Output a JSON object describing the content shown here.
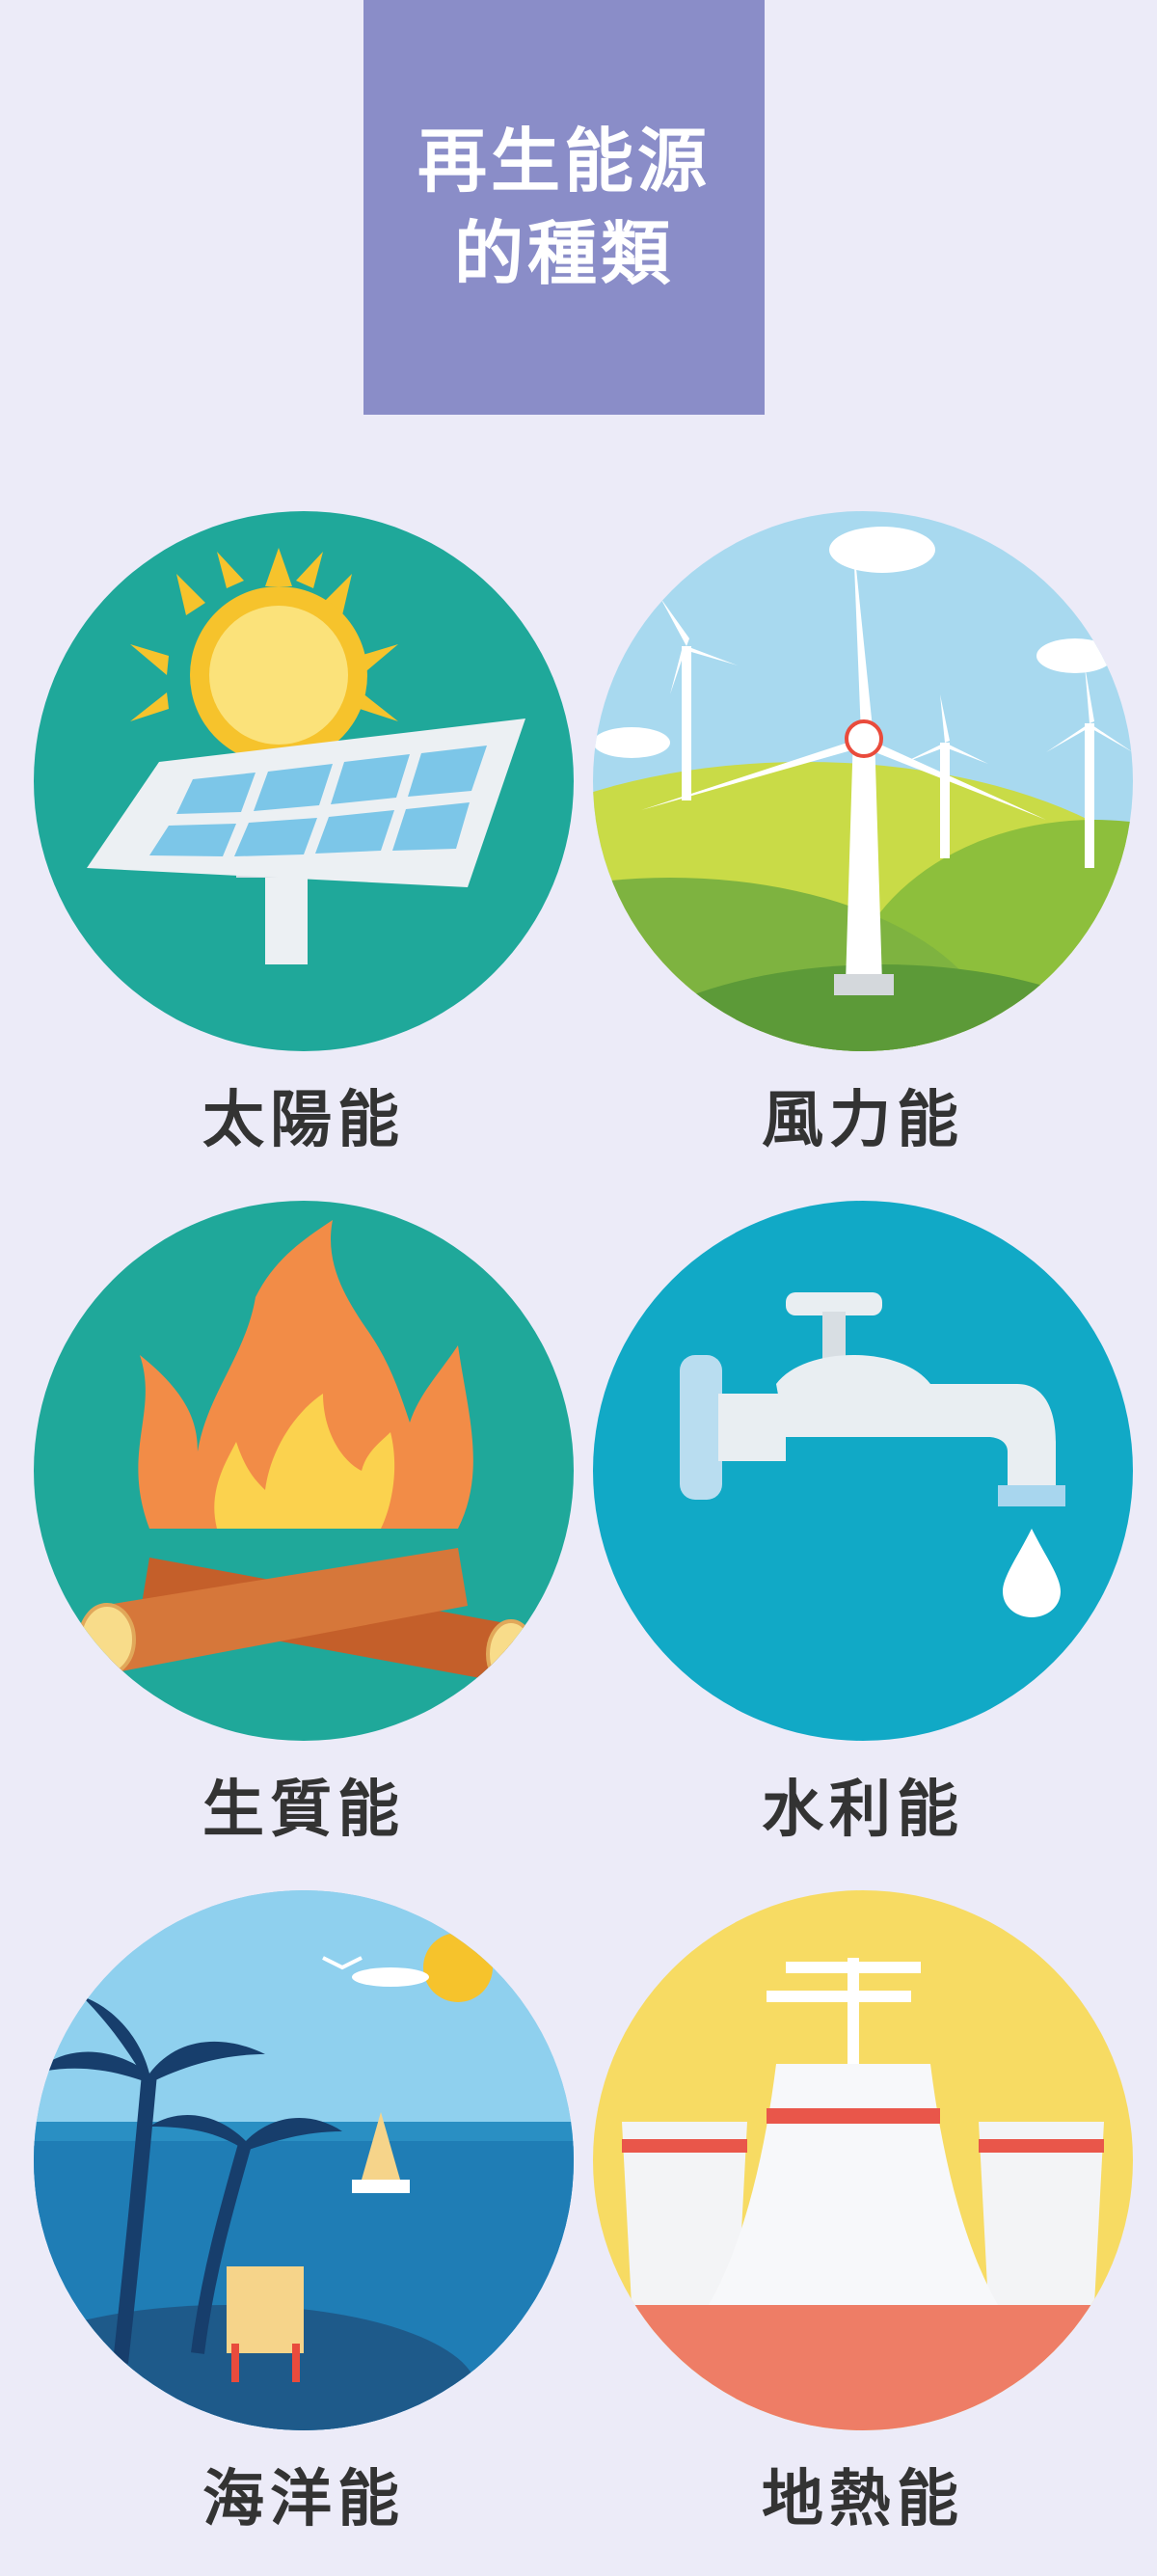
{
  "title": {
    "line1": "再生能源",
    "line2": "的種類"
  },
  "energy_types": [
    {
      "label": "太陽能",
      "icon": "solar-panel-icon",
      "bg": "#1FA89A"
    },
    {
      "label": "風力能",
      "icon": "wind-turbine-icon",
      "bg": "#A8D9EF"
    },
    {
      "label": "生質能",
      "icon": "campfire-icon",
      "bg": "#1FA89A"
    },
    {
      "label": "水利能",
      "icon": "water-faucet-icon",
      "bg": "#11A9C6"
    },
    {
      "label": "海洋能",
      "icon": "ocean-island-icon",
      "bg": "#7FC9EA"
    },
    {
      "label": "地熱能",
      "icon": "geothermal-plant-icon",
      "bg": "#F7DB63"
    }
  ],
  "colors": {
    "page_bg": "#ECEBF8",
    "title_bg": "#8A8DC8",
    "title_text": "#FFFFFF",
    "label_text": "#333333"
  }
}
